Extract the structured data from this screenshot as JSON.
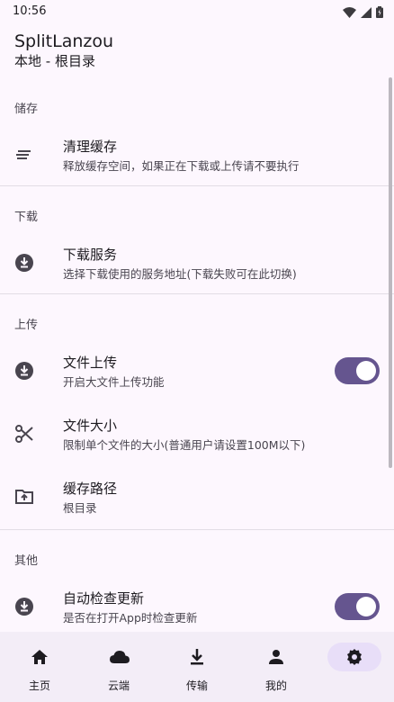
{
  "status_bar": {
    "time": "10:56"
  },
  "header": {
    "title": "SplitLanzou",
    "subtitle": "本地 - 根目录"
  },
  "sections": {
    "storage": {
      "header": "储存",
      "clear_cache": {
        "title": "清理缓存",
        "summary": "释放缓存空间，如果正在下载或上传请不要执行",
        "icon": "clear-lines-icon"
      }
    },
    "download": {
      "header": "下载",
      "download_service": {
        "title": "下载服务",
        "summary": "选择下载使用的服务地址(下载失败可在此切换)",
        "icon": "download-circle-icon"
      }
    },
    "upload": {
      "header": "上传",
      "file_upload": {
        "title": "文件上传",
        "summary": "开启大文件上传功能",
        "icon": "download-circle-icon",
        "enabled": true
      },
      "file_size": {
        "title": "文件大小",
        "summary": "限制单个文件的大小(普通用户请设置100M以下)",
        "icon": "scissors-icon"
      },
      "cache_path": {
        "title": "缓存路径",
        "summary": "根目录",
        "icon": "folder-upload-icon"
      }
    },
    "other": {
      "header": "其他",
      "auto_update": {
        "title": "自动检查更新",
        "summary": "是否在打开App时检查更新",
        "icon": "download-circle-icon",
        "enabled": true
      }
    }
  },
  "bottom_nav": {
    "items": [
      {
        "label": "主页",
        "icon": "home-icon"
      },
      {
        "label": "云端",
        "icon": "cloud-icon"
      },
      {
        "label": "传输",
        "icon": "download-icon"
      },
      {
        "label": "我的",
        "icon": "person-icon"
      },
      {
        "label": "",
        "icon": "settings-icon",
        "active": true
      }
    ]
  },
  "colors": {
    "background": "#fdf7fe",
    "accent": "#65558f",
    "nav_background": "#f3edf7",
    "nav_active": "#e8def8"
  }
}
